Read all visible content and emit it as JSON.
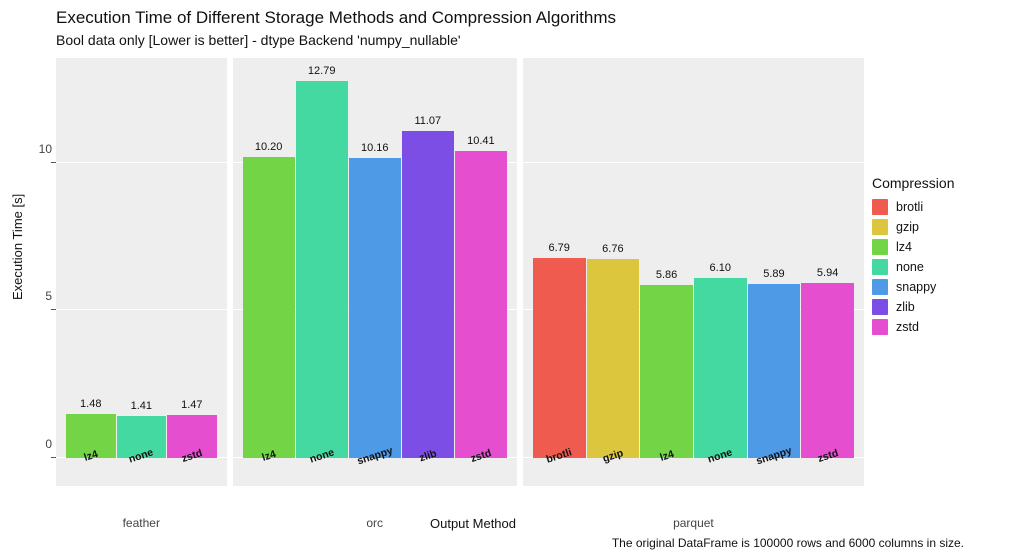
{
  "chart_data": {
    "type": "bar",
    "title": "Execution Time of Different Storage Methods and Compression Algorithms",
    "subtitle": "Bool data only [Lower is better] - dtype Backend 'numpy_nullable'",
    "ylabel": "Execution Time [s]",
    "xlabel": "Output Method",
    "caption": "The original DataFrame is 100000 rows and 6000 columns in size.",
    "legend_title": "Compression",
    "ylim": [
      0,
      13.5546875
    ],
    "yticks": [
      0,
      5,
      10
    ],
    "colors": {
      "brotli": "#f05b4f",
      "gzip": "#dcc63e",
      "lz4": "#73d546",
      "none": "#45d9a2",
      "snappy": "#4e9ae6",
      "zlib": "#7d4ee6",
      "zstd": "#e64ed0"
    },
    "compressions": [
      "brotli",
      "gzip",
      "lz4",
      "none",
      "snappy",
      "zlib",
      "zstd"
    ],
    "facets": [
      {
        "name": "feather",
        "bars": [
          {
            "comp": "lz4",
            "value": 1.48
          },
          {
            "comp": "none",
            "value": 1.41
          },
          {
            "comp": "zstd",
            "value": 1.47
          }
        ]
      },
      {
        "name": "orc",
        "bars": [
          {
            "comp": "lz4",
            "value": 10.2
          },
          {
            "comp": "none",
            "value": 12.79
          },
          {
            "comp": "snappy",
            "value": 10.16
          },
          {
            "comp": "zlib",
            "value": 11.07
          },
          {
            "comp": "zstd",
            "value": 10.41
          }
        ]
      },
      {
        "name": "parquet",
        "bars": [
          {
            "comp": "brotli",
            "value": 6.79
          },
          {
            "comp": "gzip",
            "value": 6.76
          },
          {
            "comp": "lz4",
            "value": 5.86
          },
          {
            "comp": "none",
            "value": 6.1
          },
          {
            "comp": "snappy",
            "value": 5.89
          },
          {
            "comp": "zstd",
            "value": 5.94
          }
        ]
      }
    ]
  }
}
